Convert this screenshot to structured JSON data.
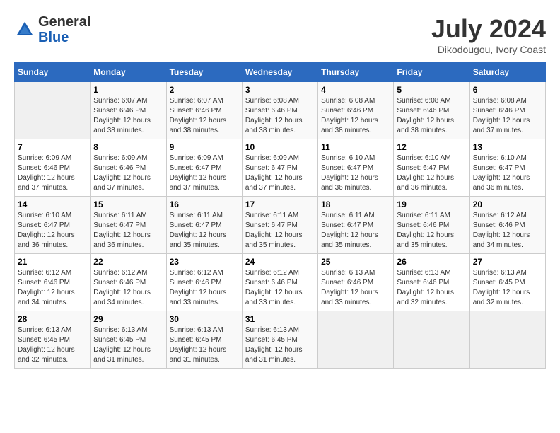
{
  "header": {
    "logo_general": "General",
    "logo_blue": "Blue",
    "month_year": "July 2024",
    "location": "Dikodougou, Ivory Coast"
  },
  "columns": [
    "Sunday",
    "Monday",
    "Tuesday",
    "Wednesday",
    "Thursday",
    "Friday",
    "Saturday"
  ],
  "weeks": [
    [
      {
        "day": "",
        "content": ""
      },
      {
        "day": "1",
        "content": "Sunrise: 6:07 AM\nSunset: 6:46 PM\nDaylight: 12 hours\nand 38 minutes."
      },
      {
        "day": "2",
        "content": "Sunrise: 6:07 AM\nSunset: 6:46 PM\nDaylight: 12 hours\nand 38 minutes."
      },
      {
        "day": "3",
        "content": "Sunrise: 6:08 AM\nSunset: 6:46 PM\nDaylight: 12 hours\nand 38 minutes."
      },
      {
        "day": "4",
        "content": "Sunrise: 6:08 AM\nSunset: 6:46 PM\nDaylight: 12 hours\nand 38 minutes."
      },
      {
        "day": "5",
        "content": "Sunrise: 6:08 AM\nSunset: 6:46 PM\nDaylight: 12 hours\nand 38 minutes."
      },
      {
        "day": "6",
        "content": "Sunrise: 6:08 AM\nSunset: 6:46 PM\nDaylight: 12 hours\nand 37 minutes."
      }
    ],
    [
      {
        "day": "7",
        "content": "Sunrise: 6:09 AM\nSunset: 6:46 PM\nDaylight: 12 hours\nand 37 minutes."
      },
      {
        "day": "8",
        "content": "Sunrise: 6:09 AM\nSunset: 6:46 PM\nDaylight: 12 hours\nand 37 minutes."
      },
      {
        "day": "9",
        "content": "Sunrise: 6:09 AM\nSunset: 6:47 PM\nDaylight: 12 hours\nand 37 minutes."
      },
      {
        "day": "10",
        "content": "Sunrise: 6:09 AM\nSunset: 6:47 PM\nDaylight: 12 hours\nand 37 minutes."
      },
      {
        "day": "11",
        "content": "Sunrise: 6:10 AM\nSunset: 6:47 PM\nDaylight: 12 hours\nand 36 minutes."
      },
      {
        "day": "12",
        "content": "Sunrise: 6:10 AM\nSunset: 6:47 PM\nDaylight: 12 hours\nand 36 minutes."
      },
      {
        "day": "13",
        "content": "Sunrise: 6:10 AM\nSunset: 6:47 PM\nDaylight: 12 hours\nand 36 minutes."
      }
    ],
    [
      {
        "day": "14",
        "content": "Sunrise: 6:10 AM\nSunset: 6:47 PM\nDaylight: 12 hours\nand 36 minutes."
      },
      {
        "day": "15",
        "content": "Sunrise: 6:11 AM\nSunset: 6:47 PM\nDaylight: 12 hours\nand 36 minutes."
      },
      {
        "day": "16",
        "content": "Sunrise: 6:11 AM\nSunset: 6:47 PM\nDaylight: 12 hours\nand 35 minutes."
      },
      {
        "day": "17",
        "content": "Sunrise: 6:11 AM\nSunset: 6:47 PM\nDaylight: 12 hours\nand 35 minutes."
      },
      {
        "day": "18",
        "content": "Sunrise: 6:11 AM\nSunset: 6:47 PM\nDaylight: 12 hours\nand 35 minutes."
      },
      {
        "day": "19",
        "content": "Sunrise: 6:11 AM\nSunset: 6:46 PM\nDaylight: 12 hours\nand 35 minutes."
      },
      {
        "day": "20",
        "content": "Sunrise: 6:12 AM\nSunset: 6:46 PM\nDaylight: 12 hours\nand 34 minutes."
      }
    ],
    [
      {
        "day": "21",
        "content": "Sunrise: 6:12 AM\nSunset: 6:46 PM\nDaylight: 12 hours\nand 34 minutes."
      },
      {
        "day": "22",
        "content": "Sunrise: 6:12 AM\nSunset: 6:46 PM\nDaylight: 12 hours\nand 34 minutes."
      },
      {
        "day": "23",
        "content": "Sunrise: 6:12 AM\nSunset: 6:46 PM\nDaylight: 12 hours\nand 33 minutes."
      },
      {
        "day": "24",
        "content": "Sunrise: 6:12 AM\nSunset: 6:46 PM\nDaylight: 12 hours\nand 33 minutes."
      },
      {
        "day": "25",
        "content": "Sunrise: 6:13 AM\nSunset: 6:46 PM\nDaylight: 12 hours\nand 33 minutes."
      },
      {
        "day": "26",
        "content": "Sunrise: 6:13 AM\nSunset: 6:46 PM\nDaylight: 12 hours\nand 32 minutes."
      },
      {
        "day": "27",
        "content": "Sunrise: 6:13 AM\nSunset: 6:45 PM\nDaylight: 12 hours\nand 32 minutes."
      }
    ],
    [
      {
        "day": "28",
        "content": "Sunrise: 6:13 AM\nSunset: 6:45 PM\nDaylight: 12 hours\nand 32 minutes."
      },
      {
        "day": "29",
        "content": "Sunrise: 6:13 AM\nSunset: 6:45 PM\nDaylight: 12 hours\nand 31 minutes."
      },
      {
        "day": "30",
        "content": "Sunrise: 6:13 AM\nSunset: 6:45 PM\nDaylight: 12 hours\nand 31 minutes."
      },
      {
        "day": "31",
        "content": "Sunrise: 6:13 AM\nSunset: 6:45 PM\nDaylight: 12 hours\nand 31 minutes."
      },
      {
        "day": "",
        "content": ""
      },
      {
        "day": "",
        "content": ""
      },
      {
        "day": "",
        "content": ""
      }
    ]
  ]
}
